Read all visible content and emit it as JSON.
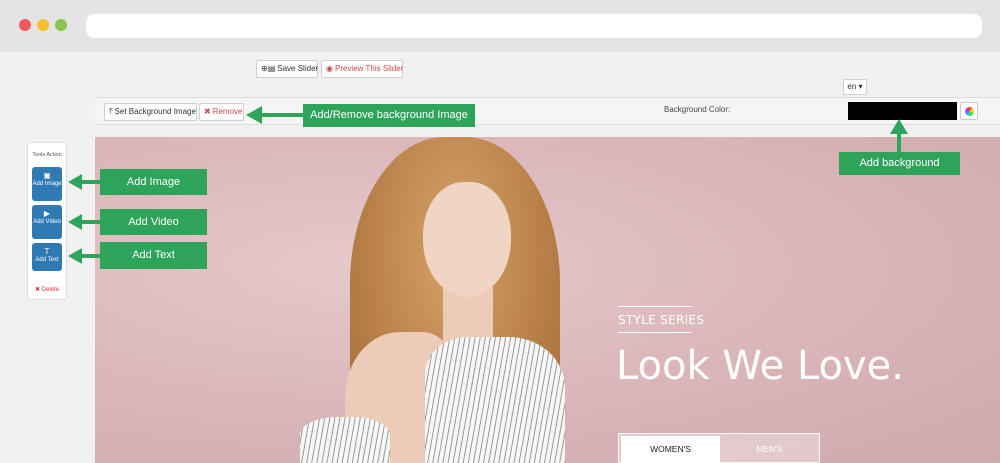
{
  "browser": {
    "url": ""
  },
  "toolbar": {
    "save_label": "Save Slider",
    "preview_label": "Preview This Slider",
    "language": "en ▾",
    "set_background_label": "Set Background Image",
    "remove_label": "Remove",
    "background_color_label": "Background Color:",
    "background_color_value": "#000000"
  },
  "tools": {
    "title": "Tools Action",
    "add_image_label": "Add Image",
    "add_video_label": "Add Video",
    "add_text_label": "Add Text",
    "delete_label": "Delete"
  },
  "slide": {
    "series": "STYLE SERIES",
    "headline": "Look We Love.",
    "tabs": [
      "WOMEN'S",
      "MEN'S"
    ]
  },
  "callouts": {
    "remove_bg": "Add/Remove background Image",
    "add_background": "Add background",
    "add_image": "Add Image",
    "add_video": "Add Video",
    "add_text": "Add Text"
  },
  "colors": {
    "callout": "#2ea45a",
    "tool_button": "#2f7ab3",
    "slide_background": "#dcb8bb"
  }
}
